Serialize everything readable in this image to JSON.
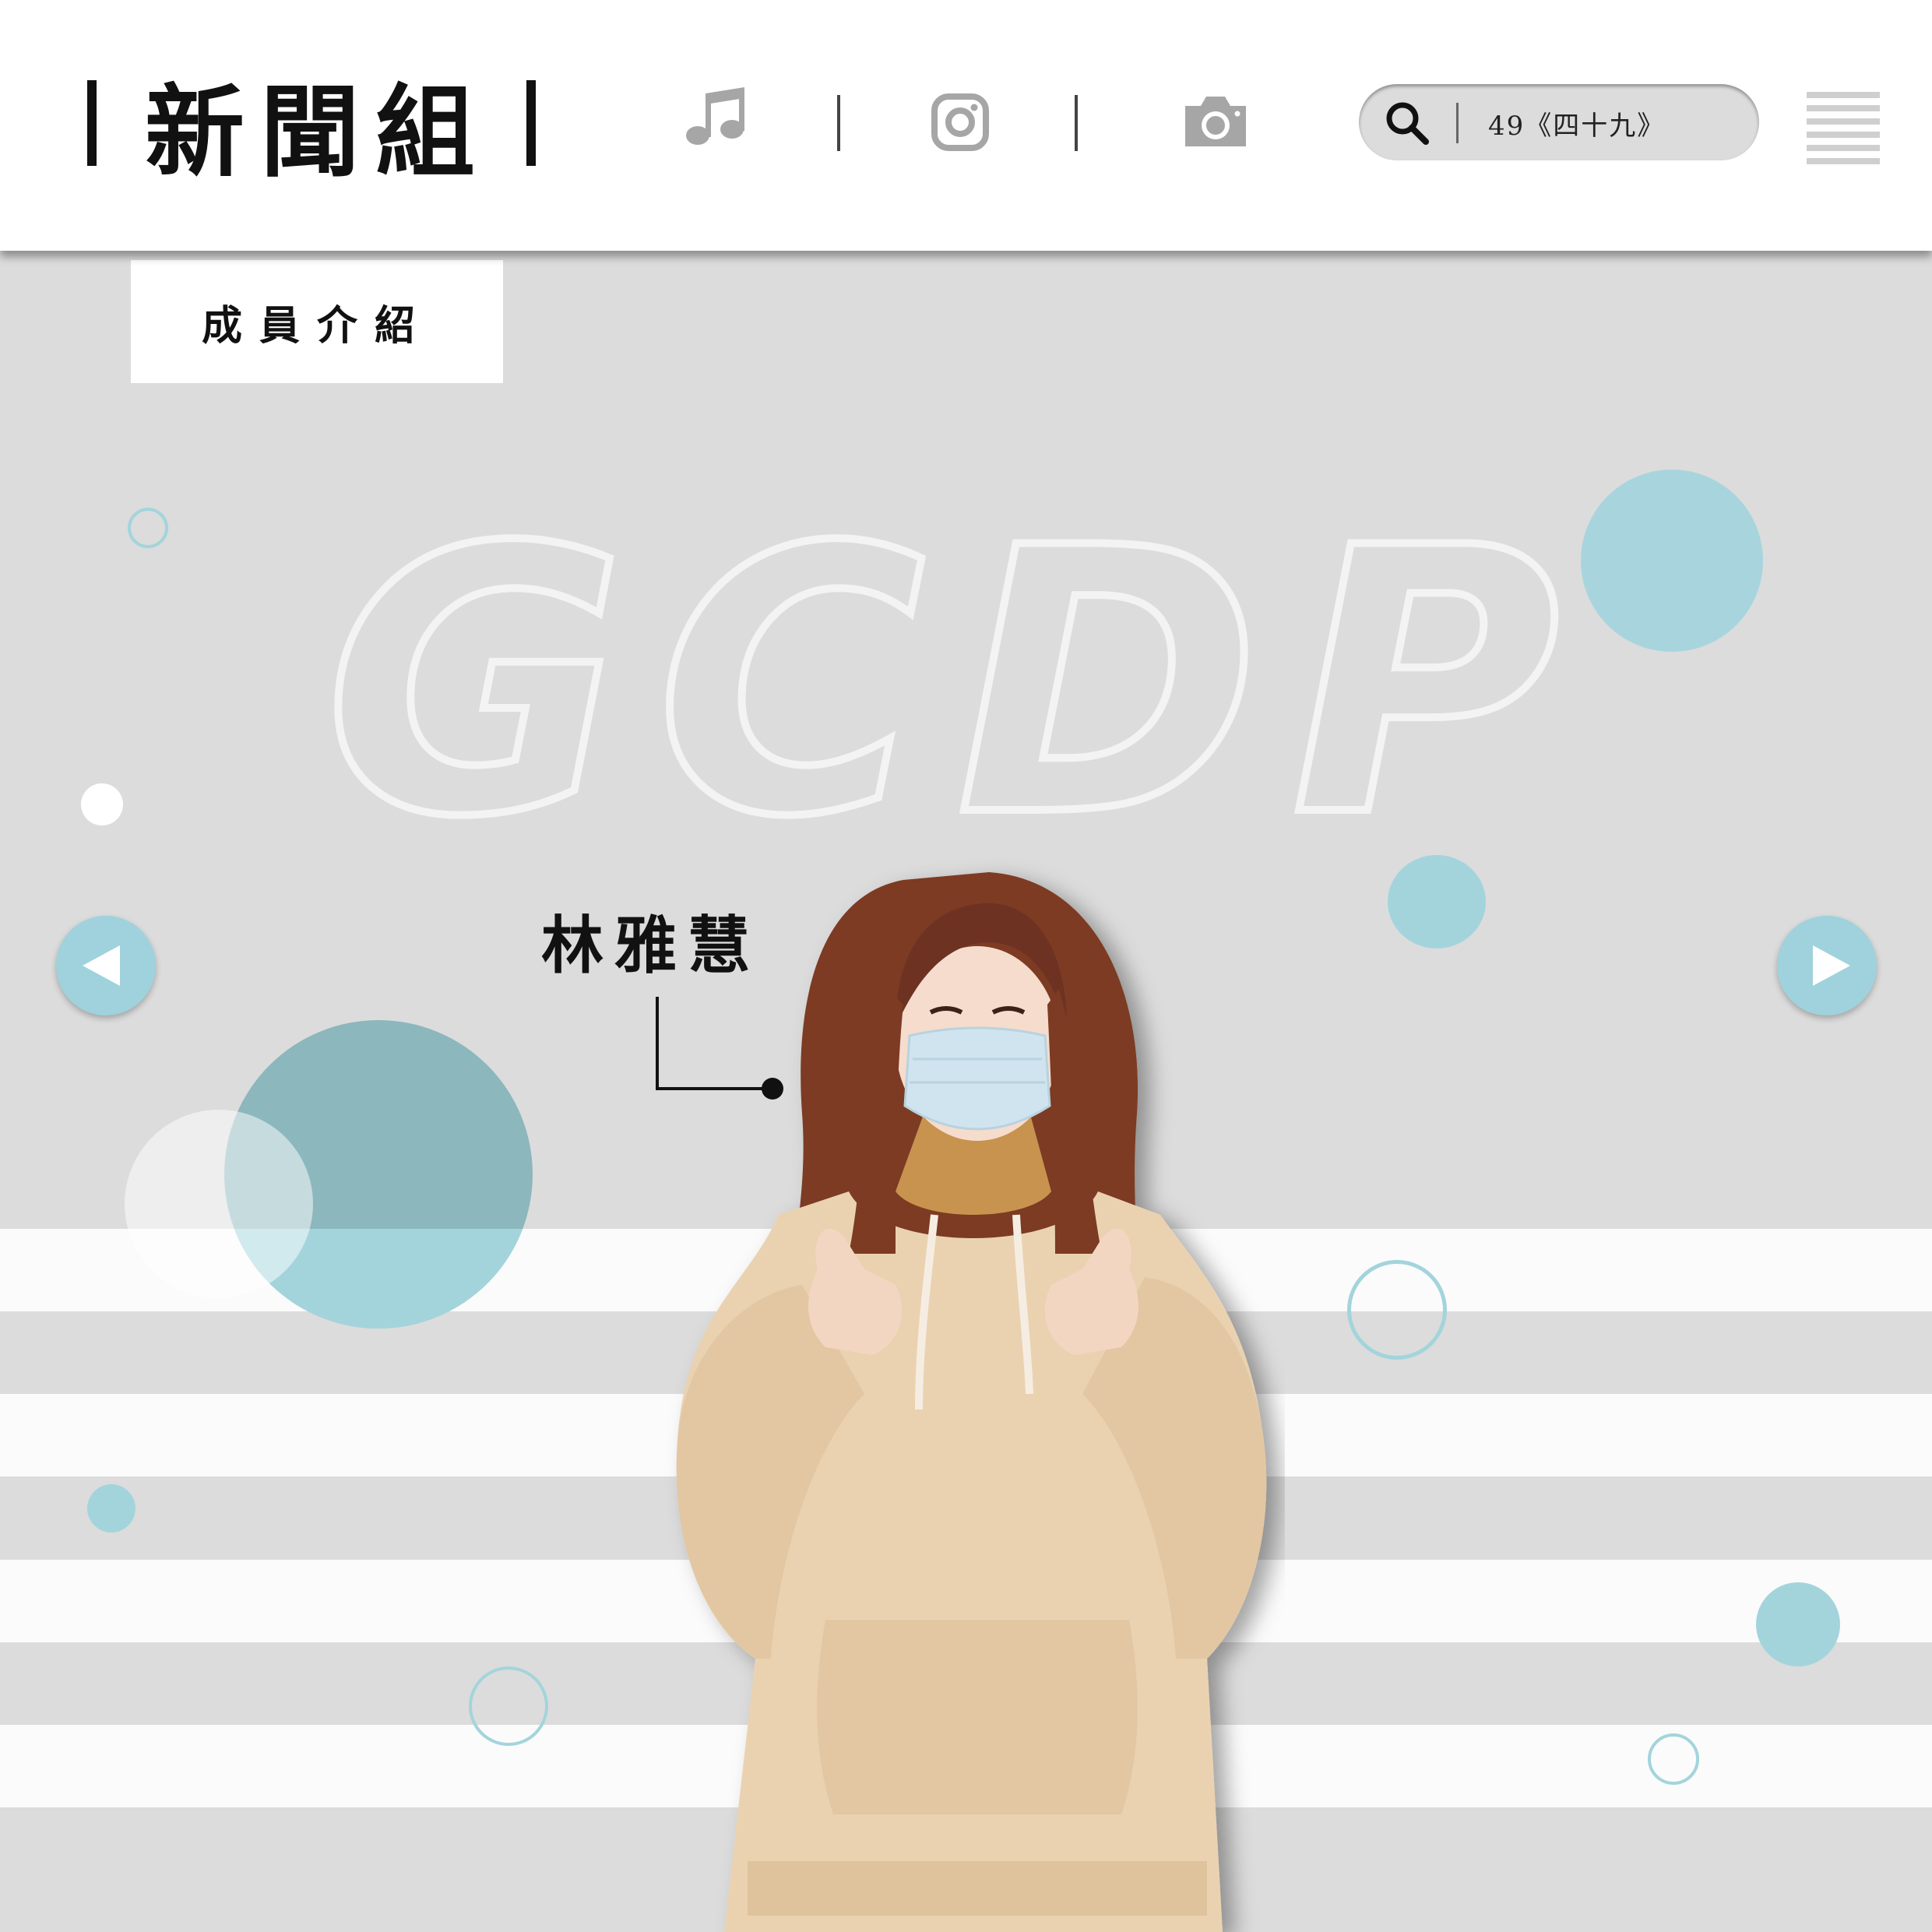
{
  "header": {
    "brand": "新聞組",
    "icons": [
      "music-note-icon",
      "instagram-icon",
      "camera-icon"
    ],
    "search": {
      "value": "49《四十九》",
      "icon": "search-icon"
    },
    "menu_icon": "hamburger-menu-icon"
  },
  "section": {
    "tag": "成員介紹"
  },
  "hero": {
    "watermark": "GCDP",
    "member_name": "林雅慧"
  },
  "colors": {
    "accent": "#a3d4dc",
    "accent_dark": "#8eb8bd",
    "background": "#dcdcdc",
    "stripe": "#fbfbfb"
  }
}
